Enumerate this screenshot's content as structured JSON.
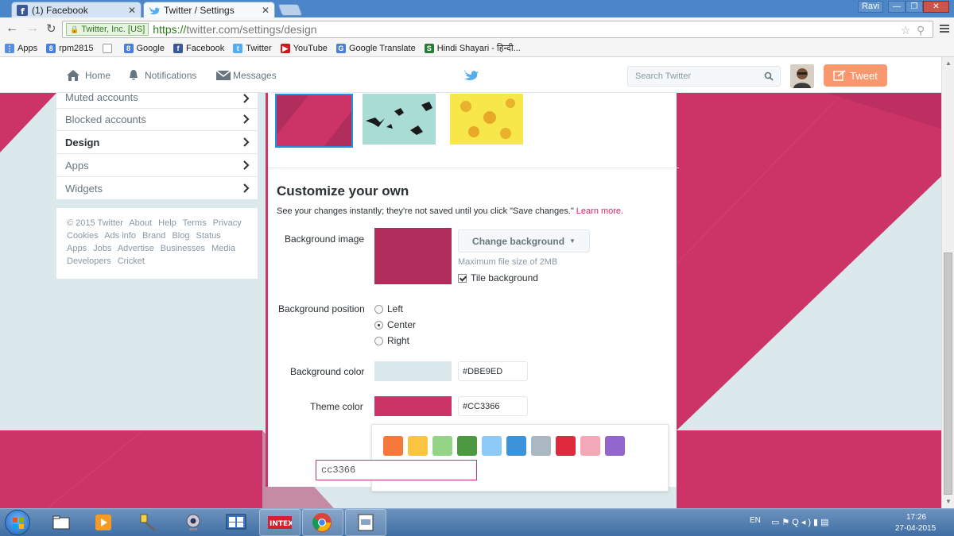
{
  "browser": {
    "tabs": [
      {
        "title": "(1) Facebook",
        "icon": "facebook-icon",
        "active": false
      },
      {
        "title": "Twitter / Settings",
        "icon": "twitter-bird-icon",
        "active": true
      }
    ],
    "window_user": "Ravi",
    "ev_badge": "Twitter, Inc. [US]",
    "url_scheme": "https://",
    "url_rest": "twitter.com/settings/design",
    "bookmarks": [
      {
        "label": "Apps",
        "icon": "apps-grid-icon",
        "color": "#5a8de0"
      },
      {
        "label": "rpm2815",
        "icon": "google-icon",
        "color": "#4a7fd6"
      },
      {
        "label": "",
        "icon": "blank-page-icon",
        "color": "#ffffff"
      },
      {
        "label": "Google",
        "icon": "google-icon",
        "color": "#4a7fd6"
      },
      {
        "label": "Facebook",
        "icon": "facebook-icon",
        "color": "#3b5998"
      },
      {
        "label": "Twitter",
        "icon": "twitter-bird-icon",
        "color": "#55acee"
      },
      {
        "label": "YouTube",
        "icon": "youtube-icon",
        "color": "#cc181e"
      },
      {
        "label": "Google Translate",
        "icon": "translate-icon",
        "color": "#4a7fd6"
      },
      {
        "label": "Hindi Shayari - हिन्दी...",
        "icon": "shayari-icon",
        "color": "#2a7a3a"
      }
    ]
  },
  "nav": {
    "home": "Home",
    "notifications": "Notifications",
    "messages": "Messages",
    "search_placeholder": "Search Twitter",
    "tweet": "Tweet"
  },
  "sidemenu": {
    "items": [
      {
        "label": "Muted accounts",
        "active": false
      },
      {
        "label": "Blocked accounts",
        "active": false
      },
      {
        "label": "Design",
        "active": true
      },
      {
        "label": "Apps",
        "active": false
      },
      {
        "label": "Widgets",
        "active": false
      }
    ],
    "footer": [
      "© 2015 Twitter",
      "About",
      "Help",
      "Terms",
      "Privacy",
      "Cookies",
      "Ads info",
      "Brand",
      "Blog",
      "Status",
      "Apps",
      "Jobs",
      "Advertise",
      "Businesses",
      "Media",
      "Developers",
      "Cricket"
    ]
  },
  "design": {
    "heading": "Customize your own",
    "hint": "See your changes instantly; they're not saved until you click \"Save changes.\"",
    "learn_more": "Learn more.",
    "bg_image_label": "Background image",
    "change_bg": "Change background",
    "max_size": "Maximum file size of 2MB",
    "tile_label": "Tile background",
    "tile_checked": true,
    "position_label": "Background position",
    "positions": [
      "Left",
      "Center",
      "Right"
    ],
    "selected_position": "Center",
    "bg_color_label": "Background color",
    "bg_color_value": "#DBE9ED",
    "theme_color_label": "Theme color",
    "theme_color_value": "#CC3366",
    "hex_typed": "cc3366",
    "palette": [
      "#f5793a",
      "#fdc441",
      "#94d487",
      "#4b9a3f",
      "#8ecaf8",
      "#3b94d9",
      "#aab8c2",
      "#e0293d",
      "#f3a8b8",
      "#9266cc"
    ]
  },
  "taskbar": {
    "lang": "EN",
    "time": "17:26",
    "date": "27-04-2015"
  }
}
